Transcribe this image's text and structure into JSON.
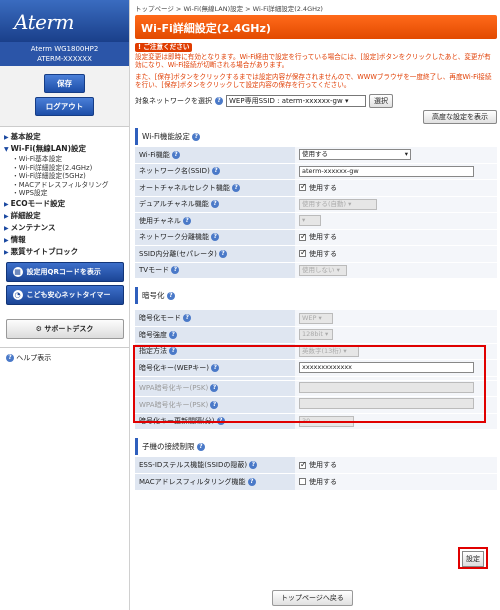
{
  "sidebar": {
    "logo": "Aterm",
    "model": "Aterm WG1800HP2",
    "device": "ATERM-XXXXXX",
    "save_label": "保存",
    "logout_label": "ログアウト",
    "nav": [
      {
        "label": "基本設定",
        "level": 1
      },
      {
        "label": "Wi-Fi(無線LAN)設定",
        "level": 1
      },
      {
        "label": "Wi-Fi基本設定",
        "level": 2
      },
      {
        "label": "Wi-Fi詳細設定(2.4GHz)",
        "level": 2
      },
      {
        "label": "Wi-Fi詳細設定(5GHz)",
        "level": 2
      },
      {
        "label": "MACアドレスフィルタリング",
        "level": 2
      },
      {
        "label": "WPS設定",
        "level": 2
      },
      {
        "label": "ECOモード設定",
        "level": 1
      },
      {
        "label": "詳細設定",
        "level": 1
      },
      {
        "label": "メンテナンス",
        "level": 1
      },
      {
        "label": "情報",
        "level": 1
      },
      {
        "label": "悪質サイトブロック",
        "level": 1
      }
    ],
    "qr_button": "設定用QRコードを表示",
    "kids_button": "こども安心ネットタイマー",
    "support_button": "サポートデスク",
    "help_label": "ヘルプ表示"
  },
  "breadcrumb": "トップページ > Wi-Fi(無線LAN)設定 > Wi-Fi詳細設定(2.4GHz)",
  "title": "Wi-Fi詳細設定(2.4GHz)",
  "notice": {
    "badge": "ご注意ください",
    "p1": "設定変更は即時に有効となります。Wi-Fi経由で設定を行っている場合には、[設定]ボタンをクリックしたあと、変更が有効になり、Wi-Fi接続が切断される場合があります。",
    "p2": "また、[保存]ボタンをクリックするまでは設定内容が保存されませんので、WWWブラウザを一度終了し、再度Wi-Fi接続を行い、[保存]ボタンをクリックして設定内容の保存を行ってください。"
  },
  "target": {
    "label": "対象ネットワークを選択",
    "value": "WEP専用SSID : aterm-xxxxxx-gw",
    "button": "選択"
  },
  "advanced_button": "高度な設定を表示",
  "sec1": {
    "title": "Wi-Fi機能設定",
    "rows": [
      {
        "label": "Wi-Fi機能",
        "type": "select",
        "value": "使用する"
      },
      {
        "label": "ネットワーク名(SSID)",
        "type": "input",
        "value": "aterm-xxxxxx-gw"
      },
      {
        "label": "オートチャネルセレクト機能",
        "type": "check",
        "value": "使用する"
      },
      {
        "label": "デュアルチャネル機能",
        "type": "dsel",
        "value": "使用する(自動)"
      },
      {
        "label": "使用チャネル",
        "type": "dsel",
        "value": ""
      },
      {
        "label": "ネットワーク分離機能",
        "type": "check",
        "value": "使用する"
      },
      {
        "label": "SSID内分離(セパレータ)",
        "type": "check",
        "value": "使用する"
      },
      {
        "label": "TVモード",
        "type": "dsel",
        "value": "使用しない"
      }
    ]
  },
  "sec2": {
    "title": "暗号化",
    "rows": [
      {
        "label": "暗号化モード",
        "value": "WEP"
      },
      {
        "label": "暗号強度",
        "value": "128bit"
      },
      {
        "label": "指定方法",
        "value": "英数字(13桁)"
      },
      {
        "label": "暗号化キー(WEPキー)",
        "value": "xxxxxxxxxxxxx"
      },
      {
        "label": "WPA暗号化キー(PSK)",
        "value": ""
      },
      {
        "label": "WPA暗号化キー(PSK)",
        "value": ""
      },
      {
        "label": "暗号化キー更新間隔(分)",
        "value": "30"
      }
    ]
  },
  "sec3": {
    "title": "子機の接続制限",
    "rows": [
      {
        "label": "ESS-IDステルス機能(SSIDの隠蔽)",
        "value": "使用する",
        "checked": true
      },
      {
        "label": "MACアドレスフィルタリング機能",
        "value": "使用する",
        "checked": false
      }
    ]
  },
  "set_button": "設定",
  "top_button": "トップページへ戻る"
}
